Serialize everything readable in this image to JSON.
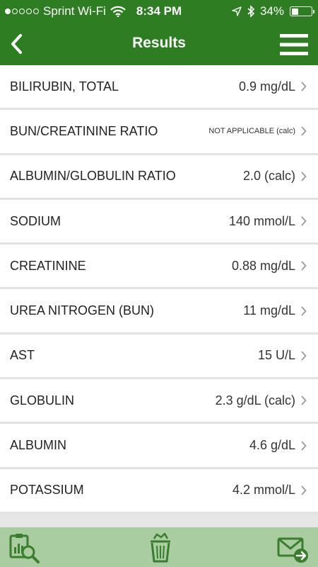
{
  "status_bar": {
    "carrier": "Sprint Wi-Fi",
    "time": "8:34 PM",
    "battery": "34%",
    "battery_level": 0.34,
    "signal_bars_filled": 1,
    "signal_bars_total": 5
  },
  "navbar": {
    "title": "Results"
  },
  "results": [
    {
      "name": "BILIRUBIN, TOTAL",
      "value": "0.9 mg/dL"
    },
    {
      "name": "BUN/CREATININE RATIO",
      "value": "NOT APPLICABLE (calc)",
      "small": true
    },
    {
      "name": "ALBUMIN/GLOBULIN RATIO",
      "value": "2.0 (calc)"
    },
    {
      "name": "SODIUM",
      "value": "140 mmol/L"
    },
    {
      "name": "CREATININE",
      "value": "0.88 mg/dL"
    },
    {
      "name": "UREA NITROGEN (BUN)",
      "value": "11 mg/dL"
    },
    {
      "name": "AST",
      "value": "15 U/L"
    },
    {
      "name": "GLOBULIN",
      "value": "2.3 g/dL (calc)"
    },
    {
      "name": "ALBUMIN",
      "value": "4.6 g/dL"
    },
    {
      "name": "POTASSIUM",
      "value": "4.2 mmol/L"
    }
  ],
  "toolbar": {
    "icons": [
      "report-search-icon",
      "trash-icon",
      "email-forward-icon"
    ]
  },
  "colors": {
    "header": "#2e7d22",
    "toolbar": "#a9cca0",
    "icon_green": "#3b7d2e"
  }
}
